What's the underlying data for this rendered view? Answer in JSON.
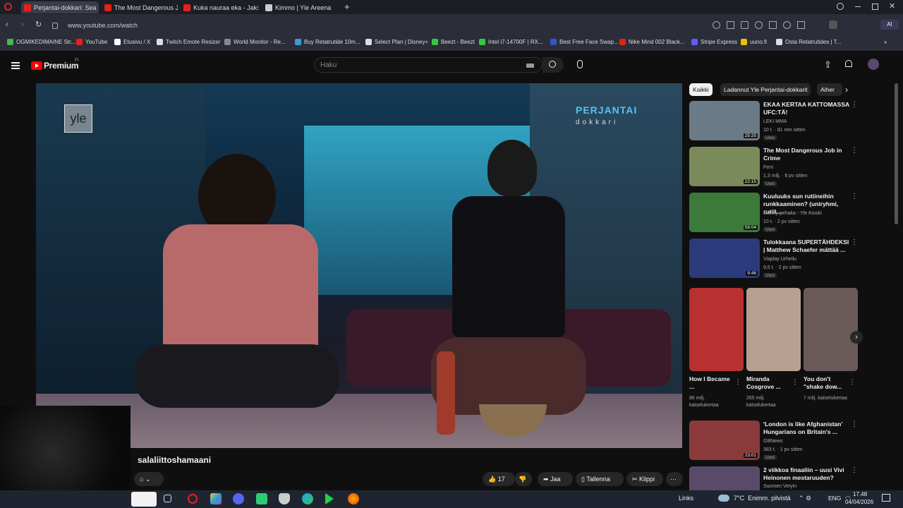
{
  "browser": {
    "tabs": [
      {
        "label": "Perjantai-dokkari: Sea",
        "color": "#e62117",
        "active": true
      },
      {
        "label": "The Most Dangerous Job",
        "color": "#e62117",
        "active": false
      },
      {
        "label": "Kuka nauraa eka - Jakso 2",
        "color": "#e62117",
        "active": false
      },
      {
        "label": "Kimmo | Yle Areena",
        "color": "#cccccc",
        "active": false
      }
    ],
    "new_tab": "+",
    "url": "www.youtube.com/watch",
    "bookmarks": [
      {
        "label": "OGMIKEDIMAINE Str...",
        "color": "#46b946"
      },
      {
        "label": "YouTube",
        "color": "#e62117"
      },
      {
        "label": "Etusivu / X",
        "color": "#ffffff"
      },
      {
        "label": "Twitch Emote Resizer",
        "color": "#dddddd"
      },
      {
        "label": "World Monitor - Re...",
        "color": "#888888"
      },
      {
        "label": "Buy Retatrutide 10m...",
        "color": "#3a9ad9"
      },
      {
        "label": "Select Plan | Disney+",
        "color": "#dddddd"
      },
      {
        "label": "Beezt - Beezt",
        "color": "#2ecc40"
      },
      {
        "label": "Intel i7-14700F | RX...",
        "color": "#2ecc40"
      },
      {
        "label": "Best Free Face Swap...",
        "color": "#3355cc"
      },
      {
        "label": "Nike Mind 002 Black...",
        "color": "#e62117"
      },
      {
        "label": "Stripe Express",
        "color": "#635bff"
      },
      {
        "label": "uuno.fi",
        "color": "#f0c000"
      },
      {
        "label": "Osta Retatrutides | T...",
        "color": "#dddddd"
      }
    ]
  },
  "youtube": {
    "logo": "Premium",
    "logo_sup": "FI",
    "search_placeholder": "Haku",
    "player": {
      "watermark_left": "yle",
      "watermark_right_big": "PERJANTAI",
      "watermark_right_small": "dokkari"
    },
    "channel_name": "salaliittoshamaani",
    "actions": {
      "likes": "17",
      "share": "Jaa",
      "save": "Tallenna",
      "clip": "Klippi",
      "more": "⋯"
    },
    "chips": [
      "Kaikki",
      "Ladannut Yle Perjantai-dokkarit",
      "Aiher"
    ],
    "recommended": [
      {
        "title": "EKAA KERTAA KATTOMASSA UFC:TÄ!",
        "channel": "LEKI MMA",
        "meta": "10 t. · 81 min sitten",
        "badge": "Uusi",
        "duration": "25:25",
        "thumb": "#6a7a86"
      },
      {
        "title": "The Most Dangerous Job in Crime",
        "channel": "Fern",
        "meta": "1,3 milj. · 6 pv sitten",
        "badge": "Uusi",
        "duration": "22:15",
        "thumb": "#7b8a5a"
      },
      {
        "title": "Kuuluuks sun rutiineihin runkkaaminen? (uniryhmi, rutiil...",
        "channel": "Menny pehaka - Yle Kioski",
        "meta": "10 t. · 2 pv sitten",
        "badge": "Uusi",
        "duration": "58:04",
        "thumb": "#3c7a3a"
      },
      {
        "title": "Tulokkaana SUPERTÄHDEKSI | Matthew Schaefer mättää ...",
        "channel": "Viaplay Urheilu",
        "meta": "9,6 t. · 2 pv sitten",
        "badge": "Uusi",
        "duration": "9:46",
        "thumb": "#2a3a7a"
      },
      {
        "title": "'London is like Afghanistan' Hungarians on Britain's ...",
        "channel": "GBNews",
        "meta": "383 t. · 1 pv sitten",
        "badge": "Uusi",
        "duration": "23:01",
        "thumb": "#8a3a3a"
      },
      {
        "title": "2 viikkoa finaaliin – uusi Vivi Heinonen mestaruuden?",
        "channel": "Suomen Vetyin",
        "meta": "",
        "badge": "",
        "duration": "",
        "thumb": "#5a4a6a"
      }
    ],
    "shorts": [
      {
        "title": "How I Became ...",
        "views": "86 milj. katselukertaa",
        "thumb": "#b83030"
      },
      {
        "title": "Miranda Cosgrove ...",
        "views": "265 milj. katselukertaa",
        "thumb": "#b8a090"
      },
      {
        "title": "You don't \"shake dow...",
        "views": "7 milj. katselukertaa",
        "thumb": "#6a5a5a"
      }
    ]
  },
  "taskbar": {
    "links": "Links",
    "weather": "7°C  Enimm. pilvistä",
    "lang": "ENG",
    "time": "17.48",
    "date": "04/04/2026"
  }
}
